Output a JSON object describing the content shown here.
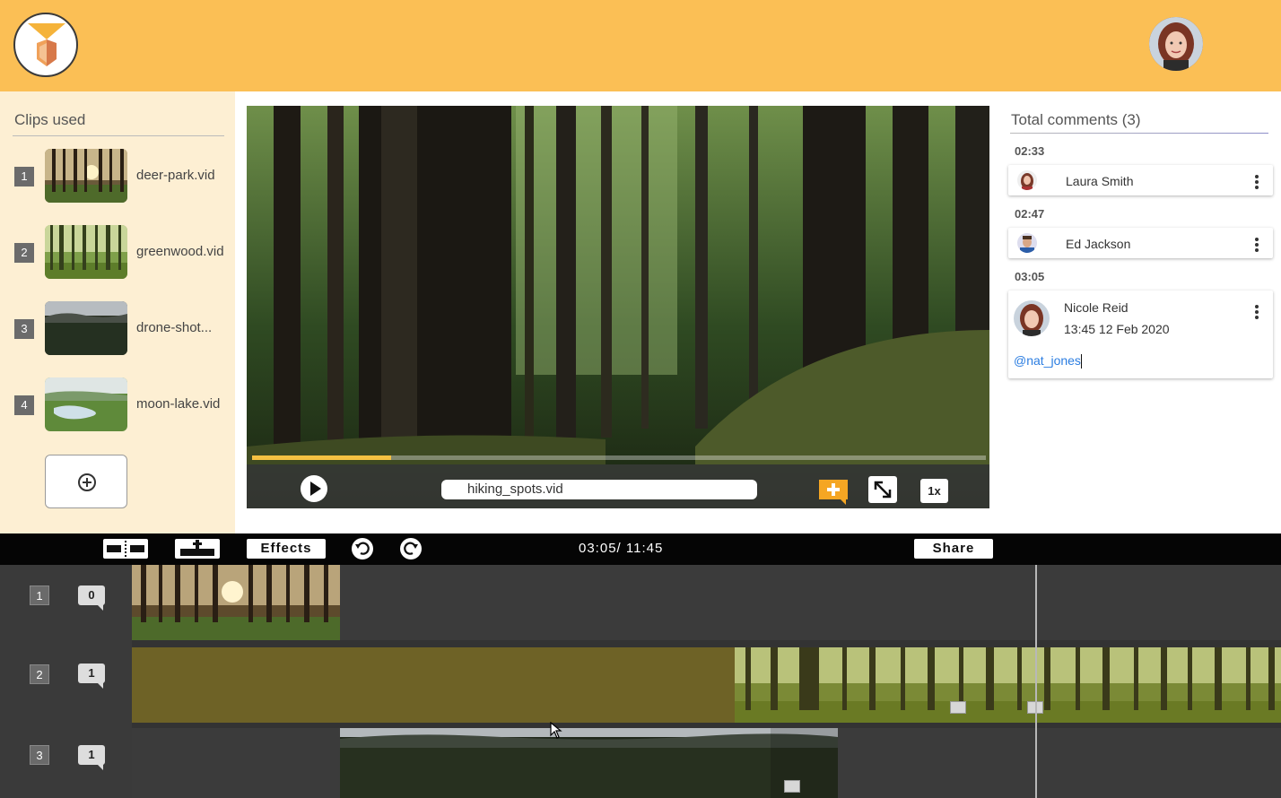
{
  "header": {
    "logo": "app-logo",
    "user_avatar": "user-avatar"
  },
  "clips_panel": {
    "title": "Clips used",
    "items": [
      {
        "number": "1",
        "name": "deer-park.vid"
      },
      {
        "number": "2",
        "name": "greenwood.vid"
      },
      {
        "number": "3",
        "name": "drone-shot..."
      },
      {
        "number": "4",
        "name": "moon-lake.vid"
      }
    ],
    "add_icon": "plus-circle-icon"
  },
  "player": {
    "filename": "hiking_spots.vid",
    "speed": "1x",
    "progress": 0.19
  },
  "comments": {
    "title": "Total comments (3)",
    "groups": [
      {
        "time": "02:33",
        "author": "Laura Smith"
      },
      {
        "time": "02:47",
        "author": "Ed Jackson"
      },
      {
        "time": "03:05",
        "author": "Nicole Reid",
        "timestamp": "13:45 12 Feb 2020",
        "mention": "@nat_jones"
      }
    ]
  },
  "toolbar": {
    "effects_label": "Effects",
    "timecode": "03:05/ 11:45",
    "share_label": "Share"
  },
  "timeline": {
    "tracks": [
      {
        "number": "1",
        "comment_count": "0"
      },
      {
        "number": "2",
        "comment_count": "1"
      },
      {
        "number": "3",
        "comment_count": "1"
      }
    ]
  },
  "colors": {
    "header": "#fbbf55",
    "sidebar": "#fdefd3",
    "accent": "#f5a623",
    "track_placeholder": "#6e6226"
  }
}
